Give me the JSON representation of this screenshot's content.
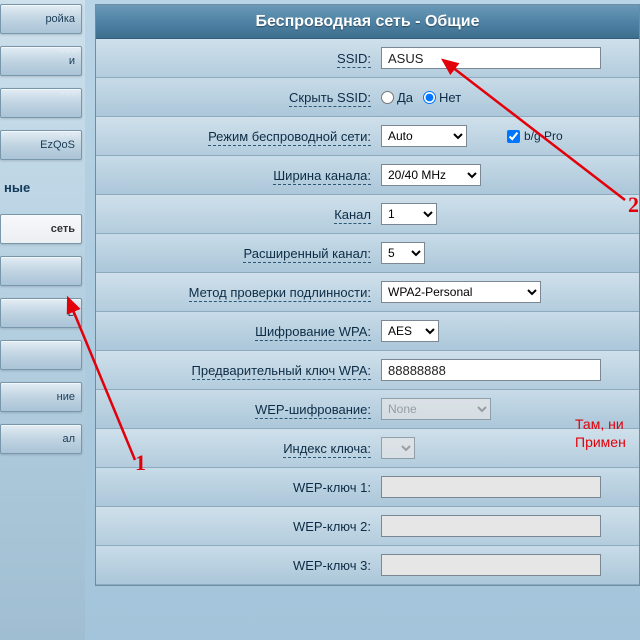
{
  "sidebar": {
    "items": [
      {
        "label": "ройка"
      },
      {
        "label": "и"
      },
      {
        "label": ""
      },
      {
        "label": "EzQoS"
      }
    ],
    "section_label": "ные",
    "selected": "сеть",
    "sub": [
      {
        "label": ""
      },
      {
        "label": "B"
      },
      {
        "label": ""
      },
      {
        "label": "ние"
      },
      {
        "label": "ал"
      }
    ]
  },
  "panel": {
    "title": "Беспроводная сеть - Общие"
  },
  "fields": {
    "ssid": {
      "label": "SSID:",
      "value": "ASUS"
    },
    "hide_ssid": {
      "label": "Скрыть SSID:",
      "yes": "Да",
      "no": "Нет",
      "value": "no"
    },
    "mode": {
      "label": "Режим беспроводной сети:",
      "value": "Auto",
      "bg": "b/g Pro"
    },
    "chwidth": {
      "label": "Ширина канала:",
      "value": "20/40 MHz"
    },
    "channel": {
      "label": "Канал",
      "value": "1"
    },
    "extch": {
      "label": "Расширенный канал:",
      "value": "5"
    },
    "auth": {
      "label": "Метод проверки подлинности:",
      "value": "WPA2-Personal"
    },
    "wpa_enc": {
      "label": "Шифрование WPA:",
      "value": "AES"
    },
    "psk": {
      "label": "Предварительный ключ WPA:",
      "value": "88888888"
    },
    "wep_enc": {
      "label": "WEP-шифрование:",
      "value": "None"
    },
    "key_index": {
      "label": "Индекс ключа:",
      "value": ""
    },
    "wep1": {
      "label": "WEP-ключ 1:",
      "value": ""
    },
    "wep2": {
      "label": "WEP-ключ 2:",
      "value": ""
    },
    "wep3": {
      "label": "WEP-ключ 3:",
      "value": ""
    }
  },
  "annotations": {
    "n1": "1",
    "n2": "2",
    "note1": "Там, ни",
    "note2": "Примен"
  }
}
